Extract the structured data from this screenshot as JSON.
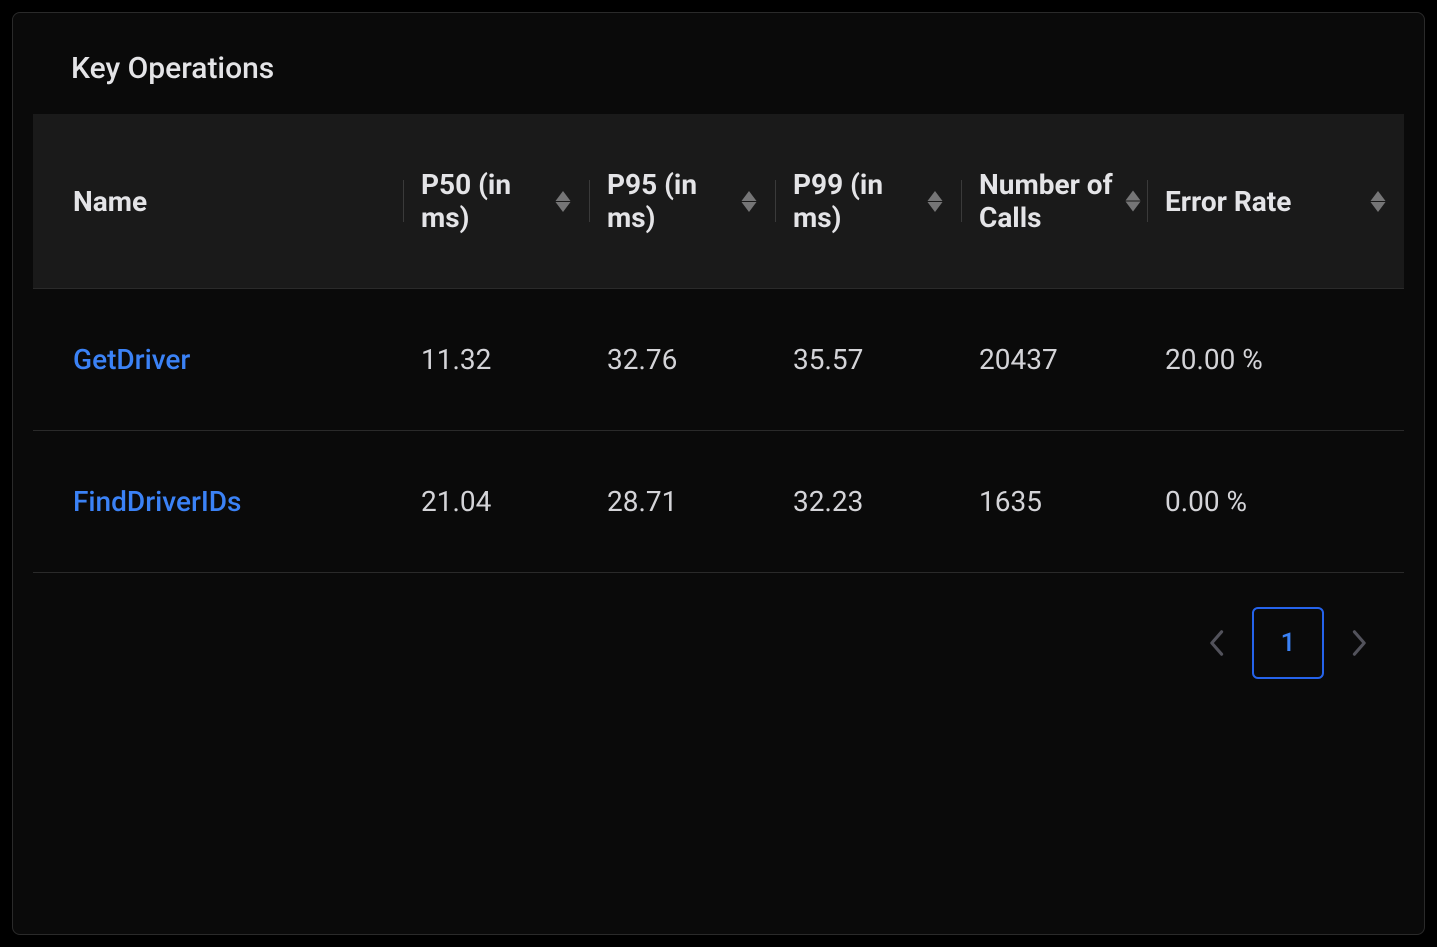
{
  "panel": {
    "title": "Key Operations"
  },
  "table": {
    "columns": {
      "name": "Name",
      "p50": "P50 (in ms)",
      "p95": "P95 (in ms)",
      "p99": "P99 (in ms)",
      "calls": "Number of Calls",
      "error": "Error Rate"
    },
    "rows": [
      {
        "name": "GetDriver",
        "p50": "11.32",
        "p95": "32.76",
        "p99": "35.57",
        "calls": "20437",
        "error": "20.00 %"
      },
      {
        "name": "FindDriverIDs",
        "p50": "21.04",
        "p95": "28.71",
        "p99": "32.23",
        "calls": "1635",
        "error": "0.00 %"
      }
    ]
  },
  "pagination": {
    "current": "1"
  }
}
